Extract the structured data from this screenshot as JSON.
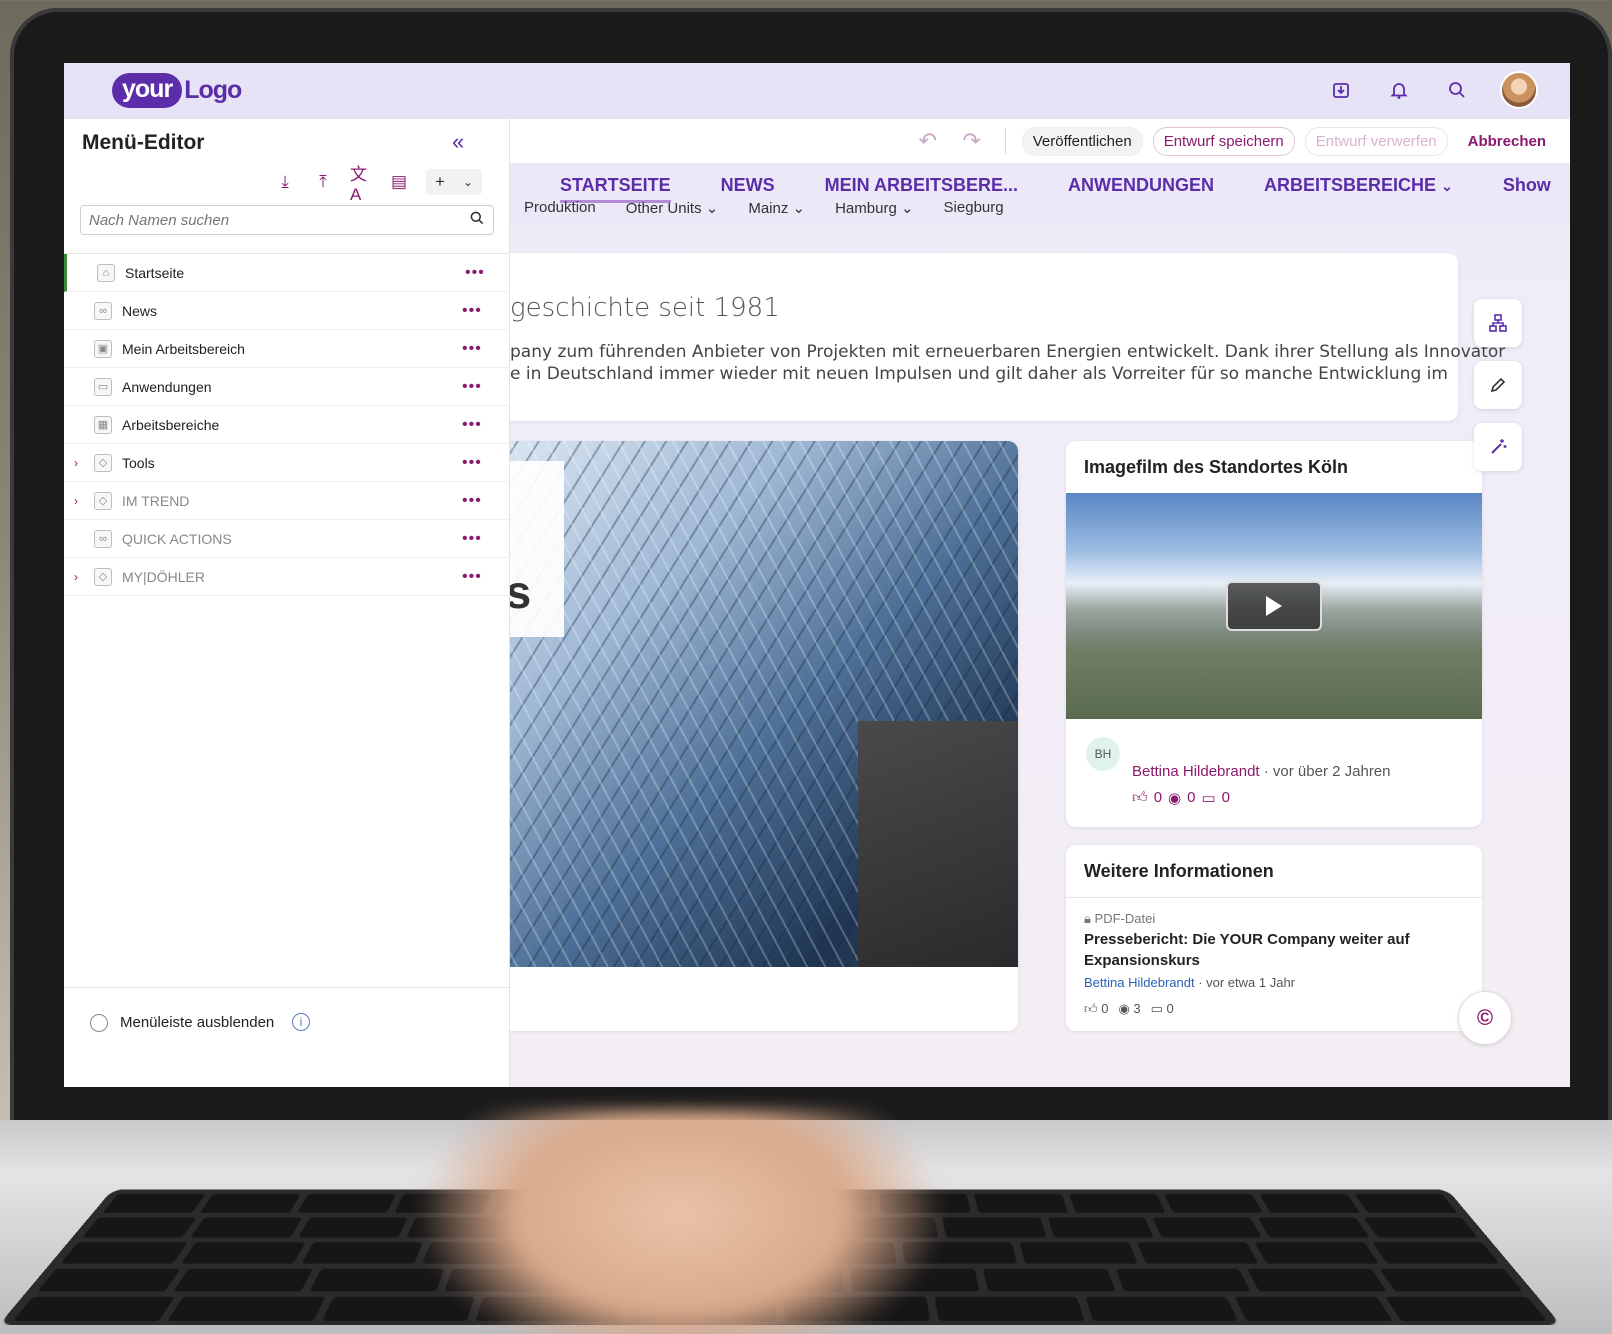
{
  "brand": {
    "pill": "your",
    "text": "Logo"
  },
  "top_icons": [
    "inbox-icon",
    "bell-icon",
    "search-icon"
  ],
  "editor_bar": {
    "publish": "Veröffentlichen",
    "save_draft": "Entwurf speichern",
    "discard_draft": "Entwurf verwerfen",
    "cancel": "Abbrechen"
  },
  "nav": {
    "items": [
      "STARTSEITE",
      "NEWS",
      "MEIN ARBEITSBERE...",
      "ANWENDUNGEN",
      "ARBEITSBEREICHE",
      "Show"
    ],
    "arbeitsbereiche_chevron": "⌄",
    "sub": [
      "Produktion",
      "Other Units",
      "Mainz",
      "Hamburg",
      "Siegburg"
    ]
  },
  "history": {
    "title": "geschichte seit 1981",
    "line1": "pany zum führenden Anbieter von Projekten mit erneuerbaren Energien entwickelt.  Dank ihrer Stellung als Innovator",
    "line2": "e in Deutschland immer wieder mit neuen Impulsen und gilt daher als Vorreiter für so manche Entwicklung im"
  },
  "image_card": {
    "overlay_text": "es"
  },
  "video_card": {
    "title": "Imagefilm des Standortes Köln",
    "initials": "BH",
    "author": "Bettina Hildebrandt",
    "time": " · vor über 2 Jahren",
    "likes": "0",
    "views": "0",
    "comments": "0"
  },
  "info_card": {
    "title": "Weitere Informationen",
    "file_type": "PDF-Datei",
    "doc_title": "Pressebericht: Die YOUR Company weiter auf Expansionskurs",
    "author": "Bettina Hildebrandt",
    "time": " · vor etwa 1 Jahr",
    "likes": "0",
    "views": "3",
    "comments": "0"
  },
  "sidebar": {
    "title": "Menü-Editor",
    "search_placeholder": "Nach Namen suchen",
    "items": [
      {
        "label": "Startseite",
        "icon": "home-icon",
        "expandable": false,
        "muted": false
      },
      {
        "label": "News",
        "icon": "link-icon",
        "expandable": false,
        "muted": false
      },
      {
        "label": "Mein Arbeitsbereich",
        "icon": "user-page-icon",
        "expandable": false,
        "muted": false
      },
      {
        "label": "Anwendungen",
        "icon": "app-icon",
        "expandable": false,
        "muted": false
      },
      {
        "label": "Arbeitsbereiche",
        "icon": "workspace-icon",
        "expandable": false,
        "muted": false
      },
      {
        "label": "Tools",
        "icon": "diamond-icon",
        "expandable": true,
        "muted": false
      },
      {
        "label": "IM TREND",
        "icon": "diamond-icon",
        "expandable": true,
        "muted": true
      },
      {
        "label": "QUICK ACTIONS",
        "icon": "link-icon",
        "expandable": false,
        "muted": true
      },
      {
        "label": "MY|DÖHLER",
        "icon": "diamond-icon",
        "expandable": true,
        "muted": true
      }
    ],
    "footer_label": "Menüleiste ausblenden"
  },
  "colors": {
    "brand": "#5b2da8",
    "accent": "#8a1a6e",
    "topbar": "#e6e3f7"
  }
}
